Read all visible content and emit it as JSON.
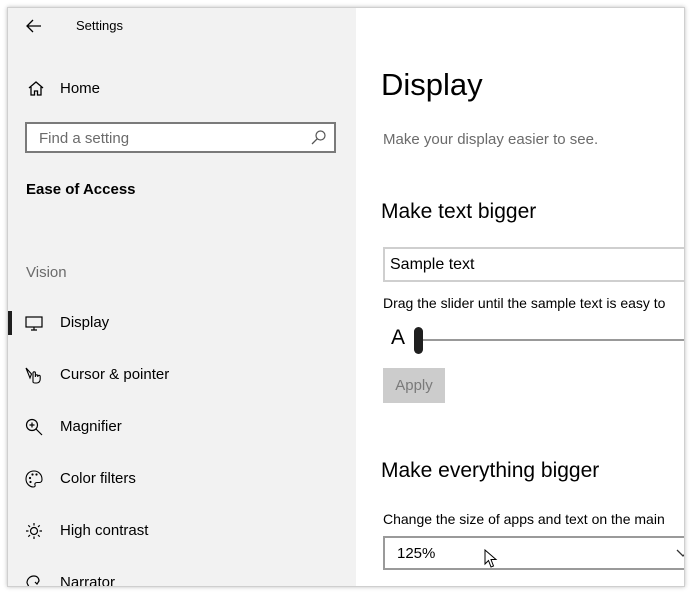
{
  "window": {
    "title": "Settings"
  },
  "sidebar": {
    "home_label": "Home",
    "search_placeholder": "Find a setting",
    "section_title": "Ease of Access",
    "group_label": "Vision",
    "items": [
      {
        "label": "Display",
        "icon": "monitor-icon",
        "selected": true
      },
      {
        "label": "Cursor & pointer",
        "icon": "pointer-icon",
        "selected": false
      },
      {
        "label": "Magnifier",
        "icon": "magnifier-icon",
        "selected": false
      },
      {
        "label": "Color filters",
        "icon": "palette-icon",
        "selected": false
      },
      {
        "label": "High contrast",
        "icon": "sun-icon",
        "selected": false
      },
      {
        "label": "Narrator",
        "icon": "narrator-icon",
        "selected": false
      }
    ]
  },
  "main": {
    "title": "Display",
    "description": "Make your display easier to see.",
    "text_section": {
      "heading": "Make text bigger",
      "sample_text": "Sample text",
      "instructions": "Drag the slider until the sample text is easy to",
      "slider_glyph": "A",
      "slider_value_fraction": 0.0,
      "apply_label": "Apply"
    },
    "everything_section": {
      "heading": "Make everything bigger",
      "instructions": "Change the size of apps and text on the main",
      "scale_value": "125%"
    }
  }
}
